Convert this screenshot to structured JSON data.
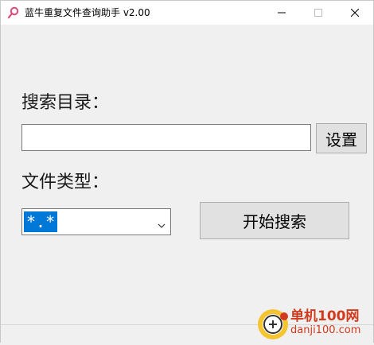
{
  "window": {
    "title": "蓝牛重复文件查询助手 v2.00"
  },
  "form": {
    "dir_label": "搜索目录：",
    "dir_value": "",
    "set_button": "设置",
    "type_label": "文件类型：",
    "type_value": "*.*",
    "search_button": "开始搜索"
  },
  "watermark": {
    "name": "单机100网",
    "url": "danji100.com"
  },
  "colors": {
    "selection": "#0078d7",
    "watermark": "#d23a1e"
  }
}
